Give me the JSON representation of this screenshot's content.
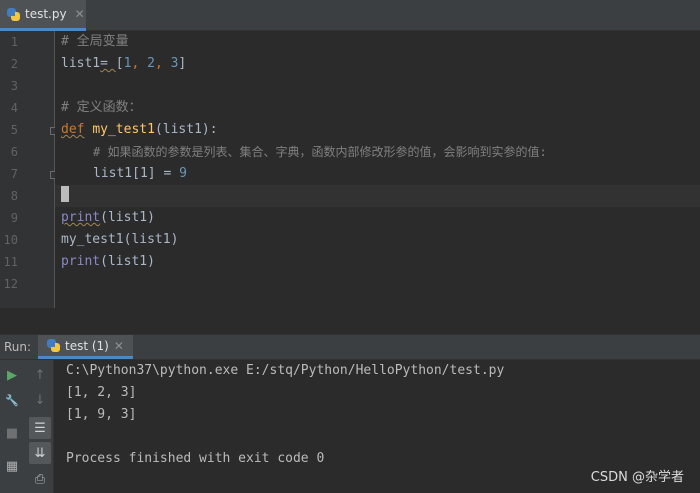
{
  "editor": {
    "tab": {
      "label": "test.py",
      "close": "✕"
    },
    "line_numbers": [
      "1",
      "2",
      "3",
      "4",
      "5",
      "6",
      "7",
      "8",
      "9",
      "10",
      "11",
      "12"
    ],
    "lines": {
      "l1": "# 全局变量",
      "l2_name": "list1",
      "l2_op": "= ",
      "l2_open": "[",
      "l2_n1": "1",
      "l2_sep1": ", ",
      "l2_n2": "2",
      "l2_sep2": ", ",
      "l2_n3": "3",
      "l2_close": "]",
      "l4": "# 定义函数：",
      "l5_kw": "def",
      "l5_name": "my_test1",
      "l5_args": "(list1):",
      "l6": "# 如果函数的参数是列表、集合、字典，函数内部修改形参的值，会影响到实参的值:",
      "l7_code": "list1[1] = ",
      "l7_num": "9",
      "l9_fn": "print",
      "l9_args": "(list1)",
      "l10": "my_test1(list1)",
      "l11_fn": "print",
      "l11_args": "(list1)"
    }
  },
  "run": {
    "title": "Run:",
    "tab_label": "test (1)",
    "tab_close": "✕",
    "output": [
      "C:\\Python37\\python.exe E:/stq/Python/HelloPython/test.py",
      "[1, 2, 3]",
      "[1, 9, 3]",
      "",
      "Process finished with exit code 0"
    ],
    "tool_icons": {
      "run": "▶",
      "up": "↑",
      "wrench": "🔧",
      "down": "↓",
      "stop": "■",
      "soft_wrap": "☰",
      "scroll_end": "⇊",
      "layout": "▦",
      "print": "⎙"
    }
  },
  "watermark": "CSDN @杂学者",
  "colors": {
    "keyword": "#cc7832",
    "function": "#ffc66d",
    "number": "#6897bb",
    "comment": "#808080",
    "builtin": "#8888c6",
    "text": "#a9b7c6",
    "accent": "#4a88c7",
    "run_green": "#59a869"
  }
}
